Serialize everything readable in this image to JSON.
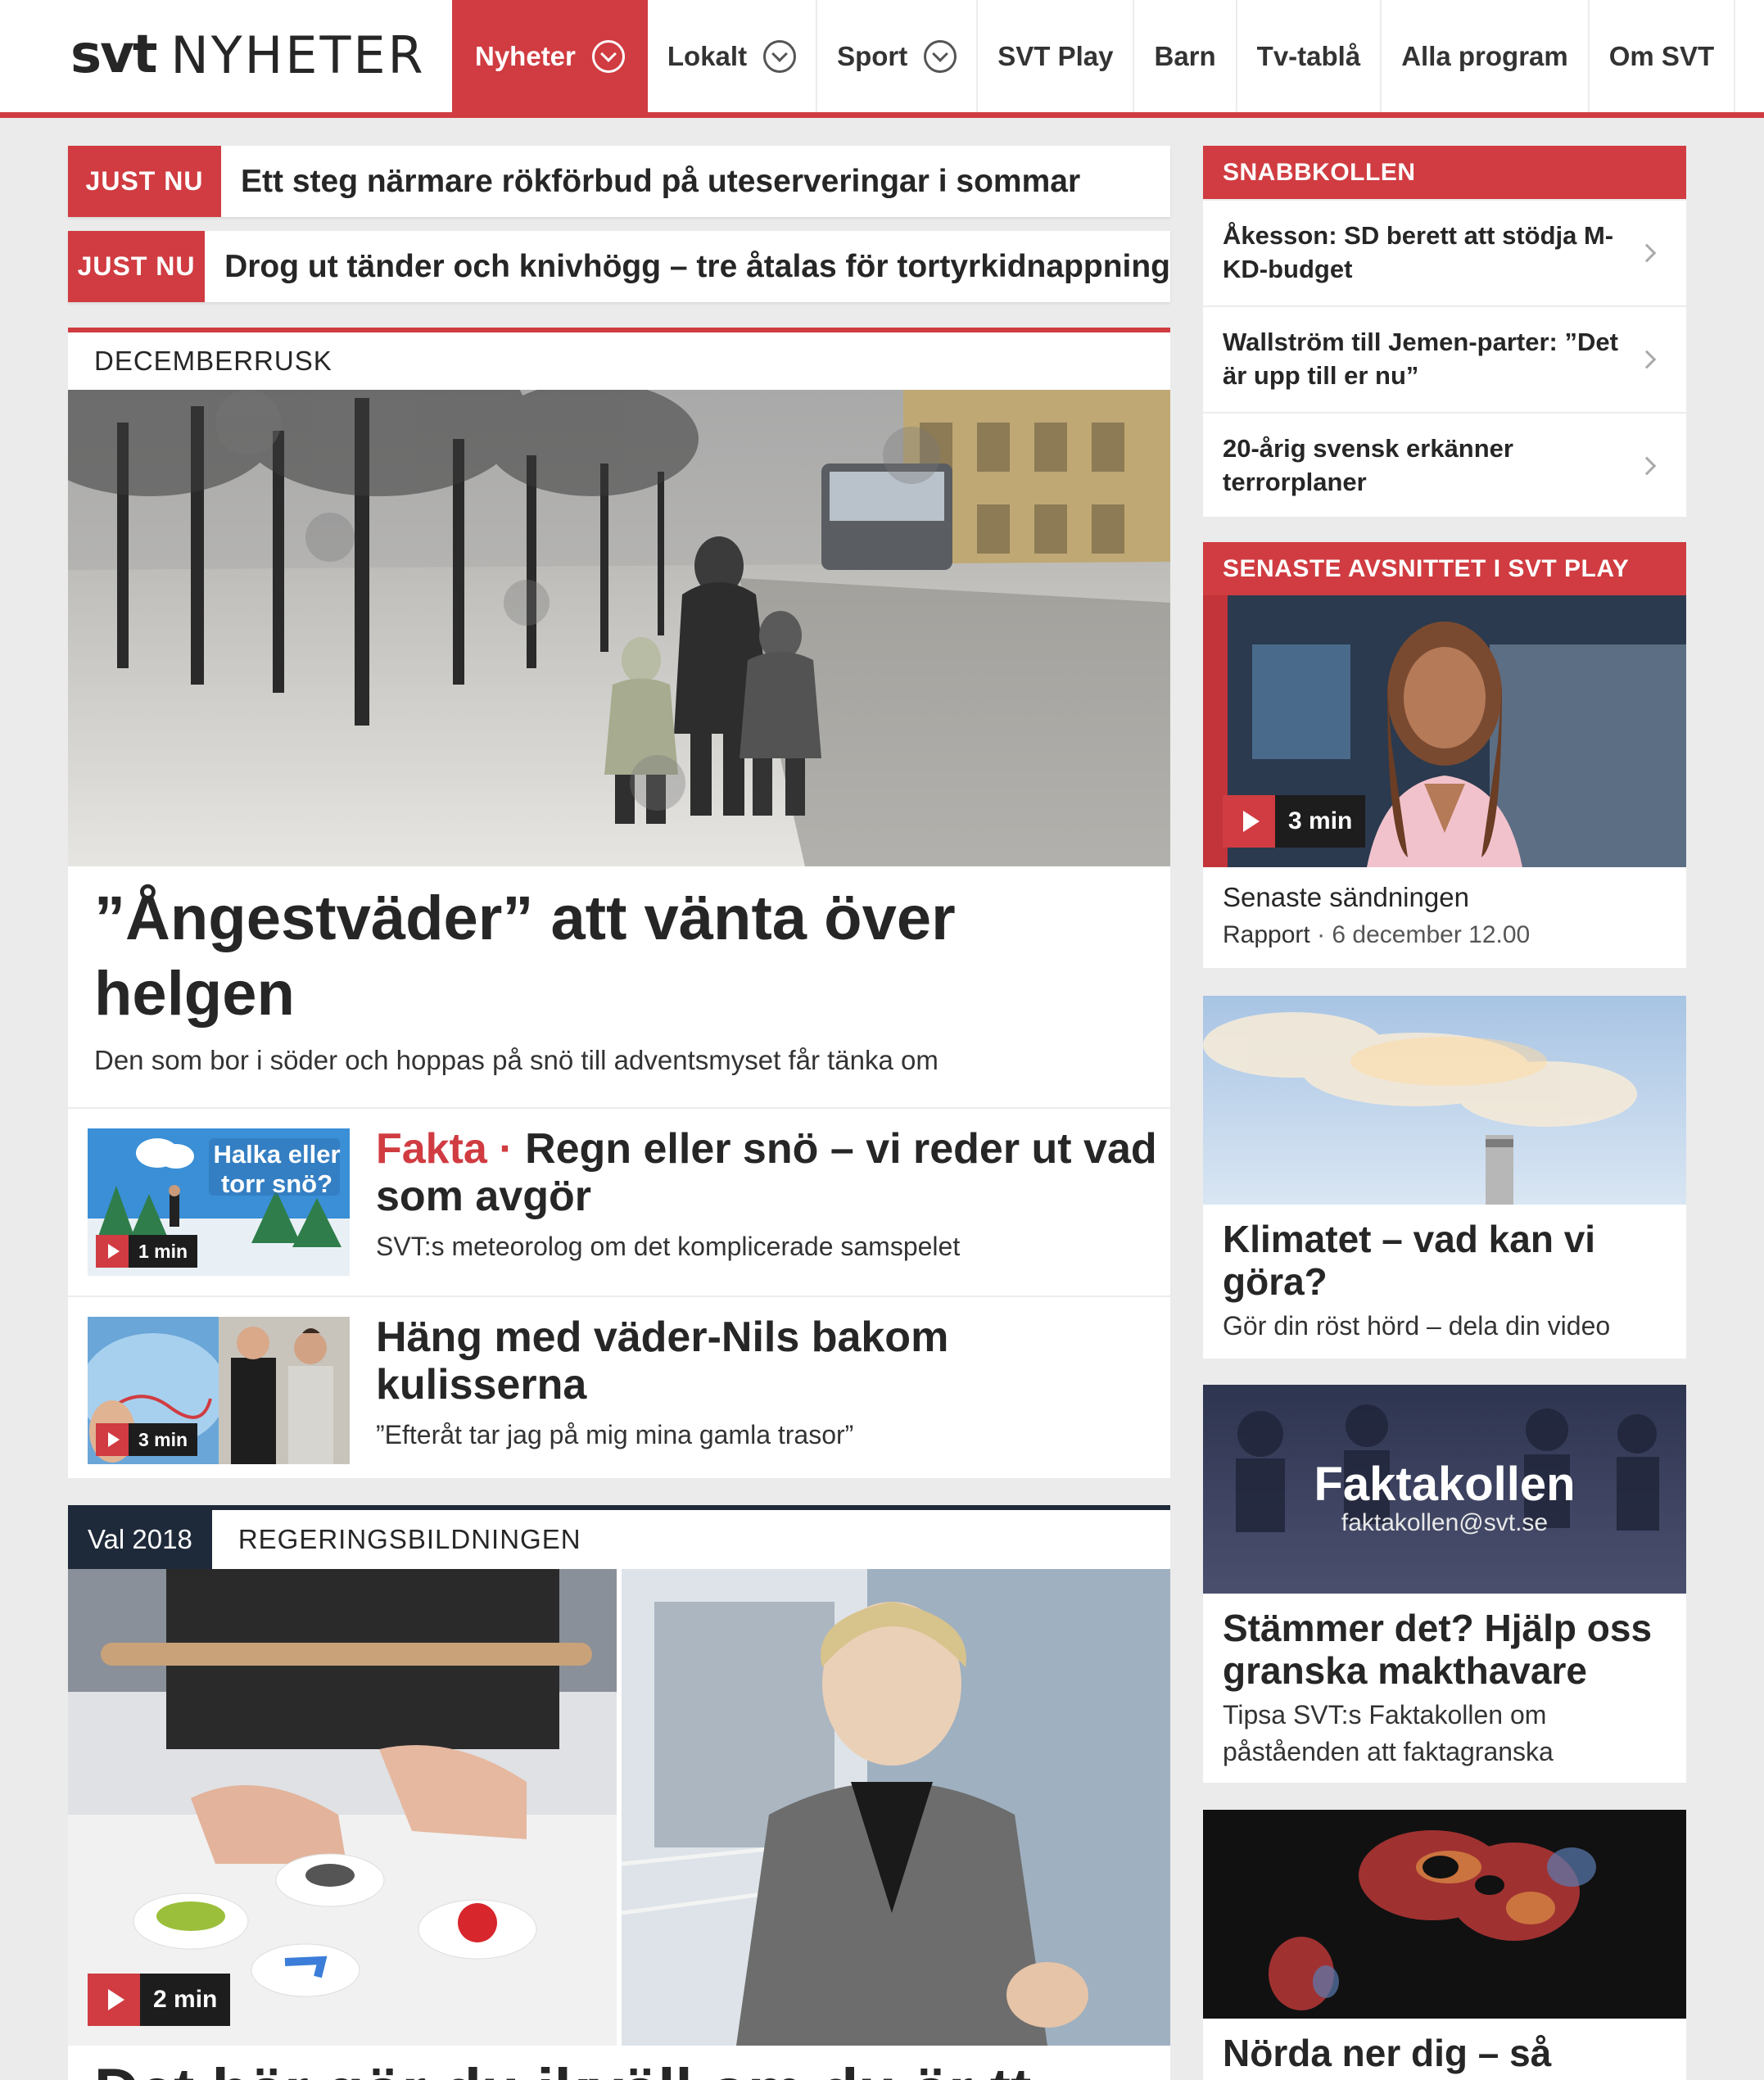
{
  "header": {
    "logo_svt": "svt",
    "logo_name": "NYHETER",
    "nav": [
      {
        "label": "Nyheter",
        "dropdown": true,
        "active": true
      },
      {
        "label": "Lokalt",
        "dropdown": true
      },
      {
        "label": "Sport",
        "dropdown": true
      },
      {
        "label": "SVT Play"
      },
      {
        "label": "Barn"
      },
      {
        "label": "Tv-tablå"
      },
      {
        "label": "Alla program"
      },
      {
        "label": "Om SVT"
      }
    ]
  },
  "justnu": [
    {
      "label": "JUST NU",
      "text": "Ett steg närmare rökförbud på uteserveringar i sommar"
    },
    {
      "label": "JUST NU",
      "text": "Drog ut tänder och knivhögg – tre åtalas för tortyrkidnappning"
    }
  ],
  "main_teaser": {
    "vignette": "DECEMBERRUSK",
    "title": "”Ångestväder” att vänta över helgen",
    "lead": "Den som bor i söder och hoppas på snö till adventsmyset får tänka om",
    "subs": [
      {
        "kicker": "Fakta ·",
        "title": "Regn eller snö – vi reder ut vad som avgör",
        "lead": "SVT:s meteorolog om det komplicerade samspelet",
        "duration": "1 min",
        "thumb_text": "Halka eller torr snö?"
      },
      {
        "kicker": "",
        "title": "Häng med väder-Nils bakom kulisserna",
        "lead": "”Efteråt tar jag på mig mina gamla trasor”",
        "duration": "3 min"
      }
    ]
  },
  "second_teaser": {
    "tag": "Val 2018",
    "vignette": "REGERINGSBILDNINGEN",
    "duration": "2 min",
    "title": "Det här gör du ikväll om du är tt"
  },
  "sidebar": {
    "snabbkollen": {
      "heading": "SNABBKOLLEN",
      "items": [
        "Åkesson: SD berett att stödja M-KD-budget",
        "Wallström till Jemen-parter: ”Det är upp till er nu”",
        "20-årig svensk erkänner terrorplaner"
      ]
    },
    "play": {
      "heading": "SENASTE AVSNITTET I SVT PLAY",
      "duration": "3 min",
      "title": "Senaste sändningen",
      "program": "Rapport",
      "date": " · 6 december 12.00"
    },
    "cards": [
      {
        "title": "Klimatet – vad kan vi göra?",
        "lead": "Gör din röst hörd – dela din video"
      },
      {
        "title": "Stämmer det? Hjälp oss granska makthavare",
        "lead": "Tipsa SVT:s Faktakollen om påståenden att faktagranska",
        "overlay_title": "Faktakollen",
        "overlay_email": "faktakollen@svt.se"
      },
      {
        "title": "Nörda ner dig – så"
      }
    ]
  },
  "colors": {
    "accent": "#d03c41",
    "dark": "#1e2a3a",
    "background": "#ebebeb"
  }
}
